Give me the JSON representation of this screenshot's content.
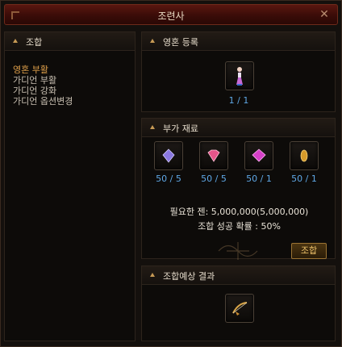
{
  "window": {
    "title": "조련사",
    "close_label": "✕"
  },
  "left_panel": {
    "header": "조합",
    "items": [
      {
        "label": "영혼 부활",
        "active": true
      },
      {
        "label": "가디언 부활",
        "active": false
      },
      {
        "label": "가디언 강화",
        "active": false
      },
      {
        "label": "가디언 옵션변경",
        "active": false
      }
    ]
  },
  "soul": {
    "header": "영혼 등록",
    "count": "1 / 1",
    "icon": "soul-doll-icon"
  },
  "materials": {
    "header": "부가 재료",
    "slots": [
      {
        "count": "50 / 5",
        "icon": "purple-gem-icon"
      },
      {
        "count": "50 / 5",
        "icon": "pink-gem-icon"
      },
      {
        "count": "50 / 1",
        "icon": "magenta-gem-icon"
      },
      {
        "count": "50 / 1",
        "icon": "gold-seed-icon"
      }
    ]
  },
  "info": {
    "required": "필요한 젠: 5,000,000(5,000,000)",
    "rate": "조합 성공 확률 : 50%"
  },
  "combine_button": "조합",
  "result": {
    "header": "조합예상 결과",
    "icon": "golden-bow-icon"
  },
  "colors": {
    "accent": "#e0a04a",
    "count": "#5fa8e6",
    "title_bar": "#5a1710"
  }
}
